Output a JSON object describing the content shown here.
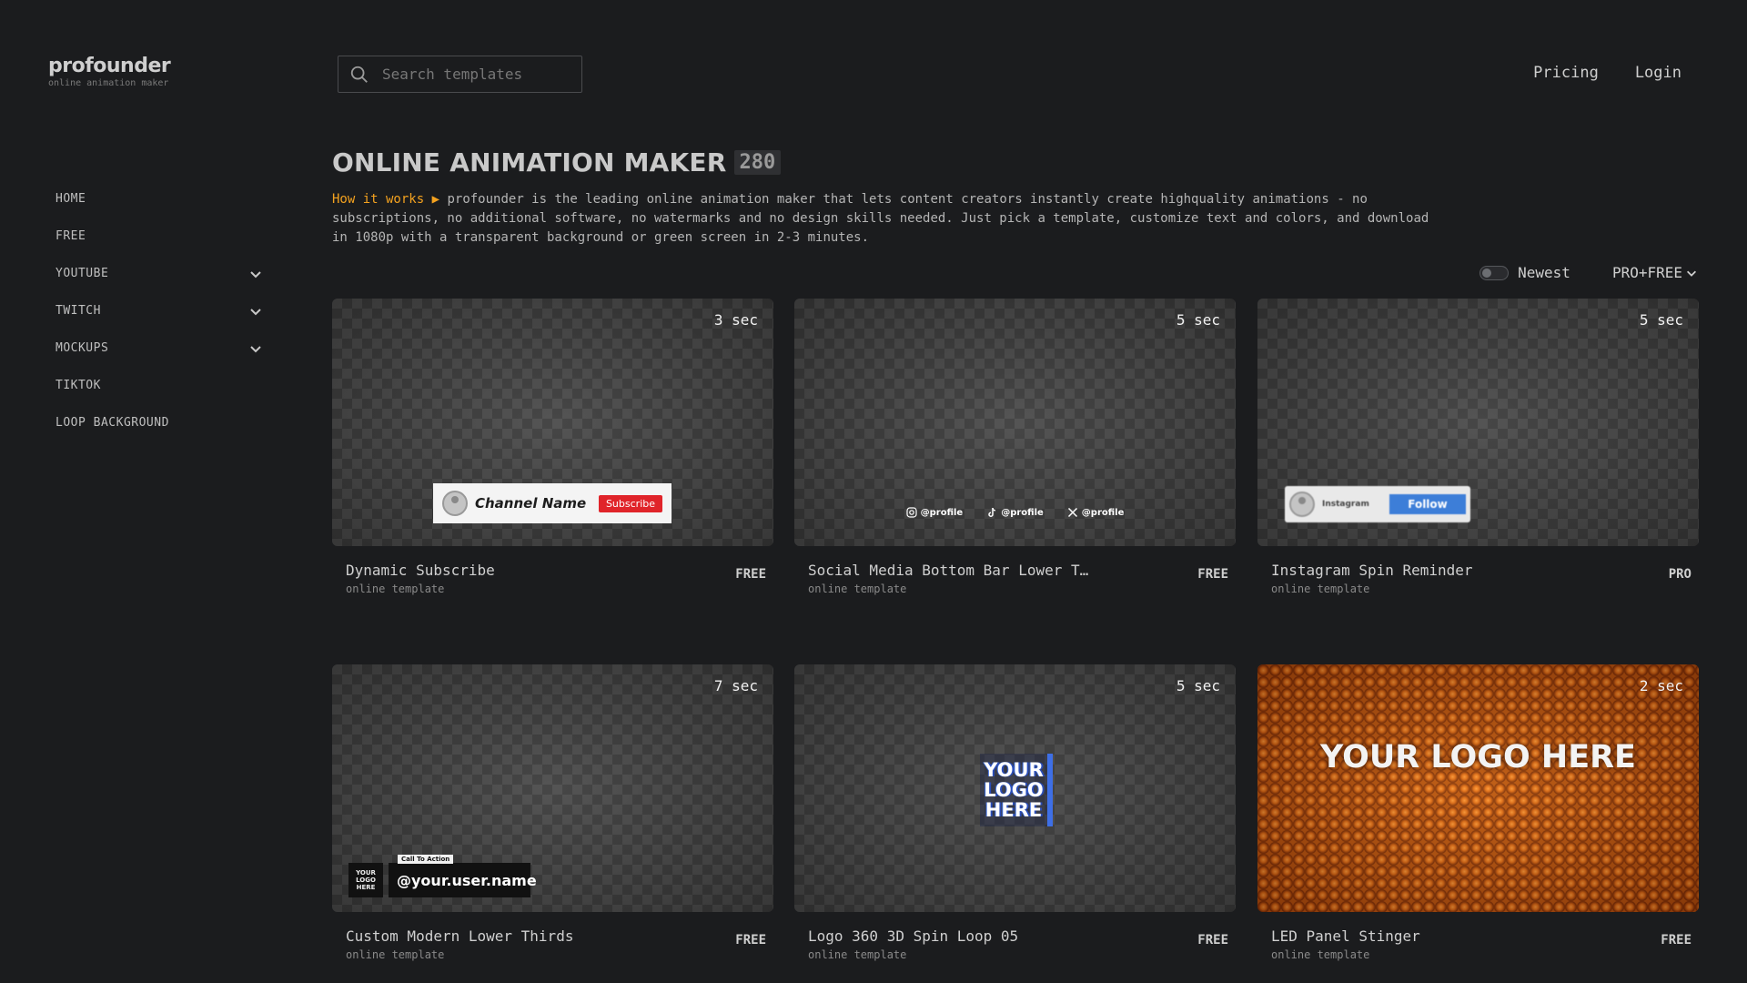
{
  "brand": {
    "name": "profounder",
    "tagline": "online animation maker"
  },
  "nav": [
    {
      "label": "HOME",
      "expandable": false
    },
    {
      "label": "FREE",
      "expandable": false
    },
    {
      "label": "YOUTUBE",
      "expandable": true
    },
    {
      "label": "TWITCH",
      "expandable": true
    },
    {
      "label": "MOCKUPS",
      "expandable": true
    },
    {
      "label": "TIKTOK",
      "expandable": false
    },
    {
      "label": "LOOP BACKGROUND",
      "expandable": false
    }
  ],
  "search": {
    "placeholder": "Search templates",
    "value": ""
  },
  "header_links": {
    "pricing": "Pricing",
    "login": "Login"
  },
  "page": {
    "title": "ONLINE ANIMATION MAKER",
    "count": "280",
    "how_it_works": "How it works",
    "description": "profounder is the leading online animation maker that lets content creators instantly create highquality animations - no subscriptions, no additional software, no watermarks and no design skills needed. Just pick a template, customize text and colors, and download in 1080p with a transparent background or green screen in 2-3 minutes."
  },
  "filters": {
    "sort_label": "Newest",
    "sort_toggle_on": false,
    "type_label": "PRO+FREE"
  },
  "accent_color": "#f4a21f",
  "cards": [
    {
      "title": "Dynamic Subscribe",
      "subtitle": "online template",
      "duration": "3 sec",
      "tier": "FREE",
      "art": {
        "channel_name": "Channel Name",
        "button": "Subscribe"
      }
    },
    {
      "title": "Social Media Bottom Bar Lower T…",
      "subtitle": "online template",
      "duration": "5 sec",
      "tier": "FREE",
      "art": {
        "instagram": "@profile",
        "tiktok": "@profile",
        "x": "@profile"
      }
    },
    {
      "title": "Instagram Spin Reminder",
      "subtitle": "online template",
      "duration": "5 sec",
      "tier": "PRO",
      "art": {
        "name": "Instagram",
        "button": "Follow"
      }
    },
    {
      "title": "Custom Modern Lower Thirds",
      "subtitle": "online template",
      "duration": "7 sec",
      "tier": "FREE",
      "art": {
        "logo": "YOUR LOGO HERE",
        "cta": "Call To Action",
        "user": "@your.user.name"
      }
    },
    {
      "title": "Logo 360 3D Spin Loop 05",
      "subtitle": "online template",
      "duration": "5 sec",
      "tier": "FREE",
      "art": {
        "logo": "YOUR LOGO HERE"
      }
    },
    {
      "title": "LED Panel Stinger",
      "subtitle": "online template",
      "duration": "2 sec",
      "tier": "FREE",
      "art": {
        "logo": "YOUR LOGO HERE"
      }
    }
  ]
}
